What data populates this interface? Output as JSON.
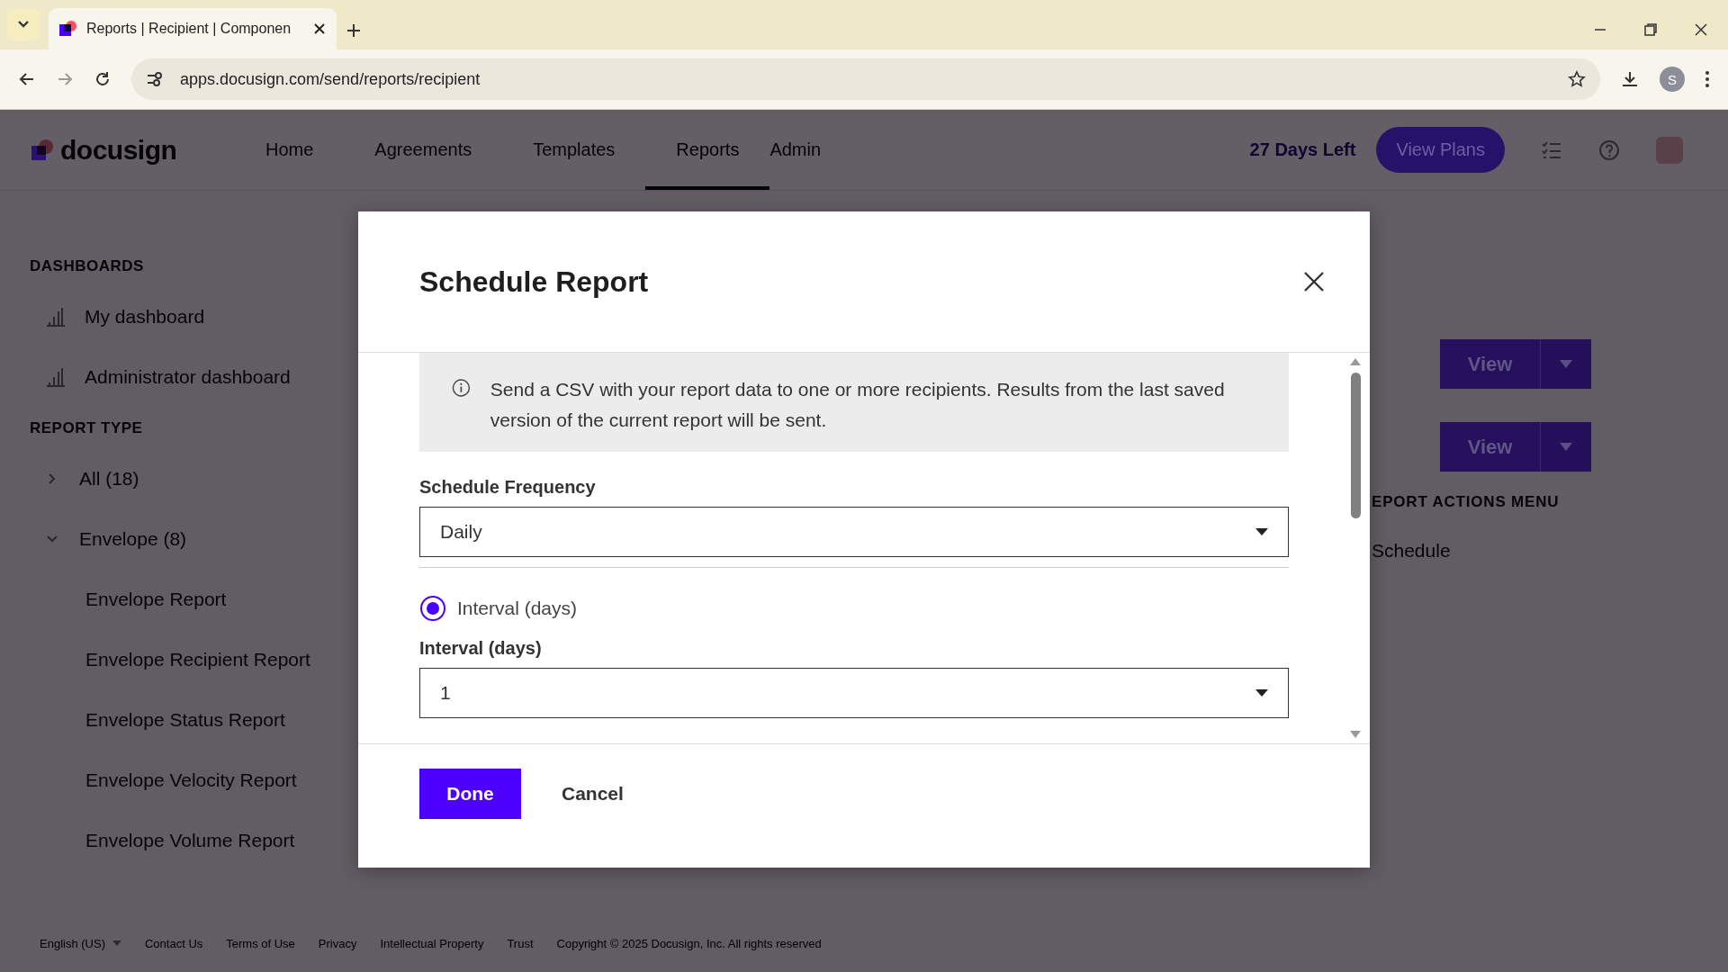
{
  "browser": {
    "tab_title": "Reports | Recipient | Componen",
    "url": "apps.docusign.com/send/reports/recipient",
    "profile_initial": "S"
  },
  "header": {
    "logo": "docusign",
    "nav": [
      {
        "label": "Home",
        "selected": false
      },
      {
        "label": "Agreements",
        "selected": false
      },
      {
        "label": "Templates",
        "selected": false
      },
      {
        "label": "Reports",
        "selected": true
      },
      {
        "label": "Admin",
        "selected": false
      }
    ],
    "trial": "27 Days Left",
    "plans_button": "View Plans"
  },
  "sidebar": {
    "sections": [
      {
        "heading": "DASHBOARDS",
        "items": [
          {
            "label": "My dashboard",
            "kind": "dashboard"
          },
          {
            "label": "Administrator dashboard",
            "kind": "dashboard"
          }
        ]
      },
      {
        "heading": "REPORT TYPE",
        "items": [
          {
            "label": "All (18)",
            "kind": "group",
            "expanded": false
          },
          {
            "label": "Envelope (8)",
            "kind": "group",
            "expanded": true,
            "children": [
              {
                "label": "Envelope Report"
              },
              {
                "label": "Envelope Recipient Report"
              },
              {
                "label": "Envelope Status Report"
              },
              {
                "label": "Envelope Velocity Report"
              },
              {
                "label": "Envelope Volume Report"
              }
            ]
          }
        ]
      }
    ]
  },
  "background": {
    "view_buttons": [
      "View",
      "View"
    ],
    "menu_heading": "EPORT ACTIONS MENU",
    "menu_items": [
      "Schedule"
    ]
  },
  "dialog": {
    "title": "Schedule Report",
    "info": "Send a CSV with your report data to one or more recipients. Results from the last saved version of the current report will be sent.",
    "frequency_label": "Schedule Frequency",
    "frequency_value": "Daily",
    "options": [
      {
        "label": "Interval (days)",
        "selected": true
      }
    ],
    "interval_label": "Interval (days)",
    "interval_value": "1",
    "buttons": [
      {
        "label": "Done",
        "kind": "primary"
      },
      {
        "label": "Cancel",
        "kind": "secondary"
      }
    ]
  },
  "footer": {
    "language": "English (US)",
    "links": [
      "Contact Us",
      "Terms of Use",
      "Privacy",
      "Intellectual Property",
      "Trust"
    ],
    "copyright": "Copyright © 2025 Docusign, Inc. All rights reserved"
  }
}
